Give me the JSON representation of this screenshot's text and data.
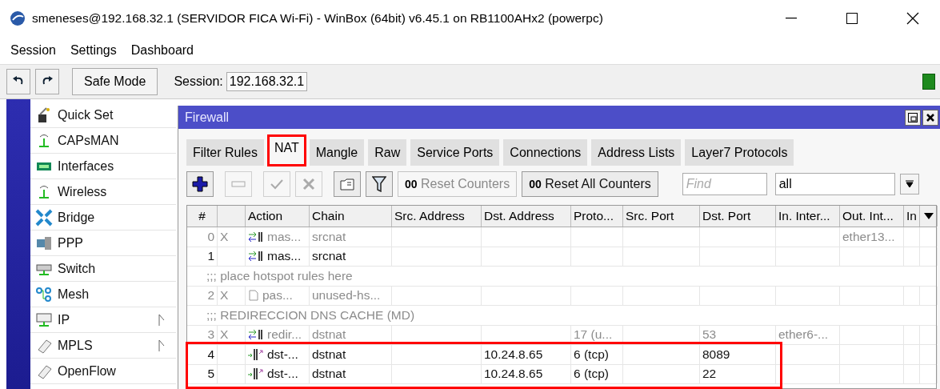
{
  "window": {
    "title": "smeneses@192.168.32.1 (SERVIDOR FICA Wi-Fi) - WinBox (64bit) v6.45.1 on RB1100AHx2 (powerpc)"
  },
  "menu": [
    "Session",
    "Settings",
    "Dashboard"
  ],
  "toolbar": {
    "safe_mode": "Safe Mode",
    "session_label": "Session:",
    "session_value": "192.168.32.1"
  },
  "sidebar": {
    "items": [
      {
        "label": "Quick Set",
        "has_submenu": false
      },
      {
        "label": "CAPsMAN",
        "has_submenu": false
      },
      {
        "label": "Interfaces",
        "has_submenu": false
      },
      {
        "label": "Wireless",
        "has_submenu": false
      },
      {
        "label": "Bridge",
        "has_submenu": false
      },
      {
        "label": "PPP",
        "has_submenu": false
      },
      {
        "label": "Switch",
        "has_submenu": false
      },
      {
        "label": "Mesh",
        "has_submenu": false
      },
      {
        "label": "IP",
        "has_submenu": true
      },
      {
        "label": "MPLS",
        "has_submenu": true
      },
      {
        "label": "OpenFlow",
        "has_submenu": false
      }
    ]
  },
  "firewall": {
    "title": "Firewall",
    "tabs": [
      {
        "label": "Filter Rules",
        "selected": false,
        "highlighted": false
      },
      {
        "label": "NAT",
        "selected": true,
        "highlighted": true
      },
      {
        "label": "Mangle",
        "selected": false,
        "highlighted": false
      },
      {
        "label": "Raw",
        "selected": false,
        "highlighted": false
      },
      {
        "label": "Service Ports",
        "selected": false,
        "highlighted": false
      },
      {
        "label": "Connections",
        "selected": false,
        "highlighted": false
      },
      {
        "label": "Address Lists",
        "selected": false,
        "highlighted": false
      },
      {
        "label": "Layer7 Protocols",
        "selected": false,
        "highlighted": false
      }
    ],
    "tools": [
      {
        "kind": "add",
        "disabled": false
      },
      {
        "kind": "remove",
        "disabled": true
      },
      {
        "kind": "enable",
        "disabled": true
      },
      {
        "kind": "disable",
        "disabled": true
      },
      {
        "kind": "comment",
        "disabled": false
      },
      {
        "kind": "filter",
        "disabled": false
      }
    ],
    "reset_buttons": [
      {
        "label": "**00** Reset Counters",
        "disabled": true
      },
      {
        "label": "**00** Reset All Counters",
        "disabled": false
      }
    ],
    "find": {
      "placeholder": "Find"
    },
    "filter_value": "all",
    "columns": [
      "#",
      "",
      "Action",
      "Chain",
      "Src. Address",
      "Dst. Address",
      "Proto...",
      "Src. Port",
      "Dst. Port",
      "In. Inter...",
      "Out. Int...",
      "In"
    ],
    "rows": [
      {
        "kind": "masquerade",
        "disabled": true,
        "highlighted": false,
        "number": "0",
        "flag": "X",
        "action": "mas...",
        "chain": "srcnat",
        "out_interface": "ether13..."
      },
      {
        "kind": "masquerade",
        "disabled": false,
        "highlighted": false,
        "number": "1",
        "action": "mas...",
        "chain": "srcnat"
      },
      {
        "kind": "comment",
        "text": ";;; place hotspot rules here"
      },
      {
        "kind": "passthrough",
        "disabled": true,
        "highlighted": false,
        "number": "2",
        "flag": "X",
        "action": "pas...",
        "chain": "unused-hs..."
      },
      {
        "kind": "comment",
        "text": ";;; REDIRECCION DNS CACHE (MD)"
      },
      {
        "kind": "masquerade",
        "disabled": true,
        "highlighted": false,
        "number": "3",
        "flag": "X",
        "action": "redir...",
        "chain": "dstnat",
        "protocol": "17 (u...",
        "dst_port": "53",
        "in_interface": "ether6-..."
      },
      {
        "kind": "dst-nat",
        "disabled": false,
        "highlighted": true,
        "number": "4",
        "action": "dst-...",
        "chain": "dstnat",
        "dst_address": "10.24.8.65",
        "protocol": "6 (tcp)",
        "dst_port": "8089"
      },
      {
        "kind": "dst-nat",
        "disabled": false,
        "highlighted": true,
        "number": "5",
        "action": "dst-...",
        "chain": "dstnat",
        "dst_address": "10.24.8.65",
        "protocol": "6 (tcp)",
        "dst_port": "22"
      }
    ]
  }
}
